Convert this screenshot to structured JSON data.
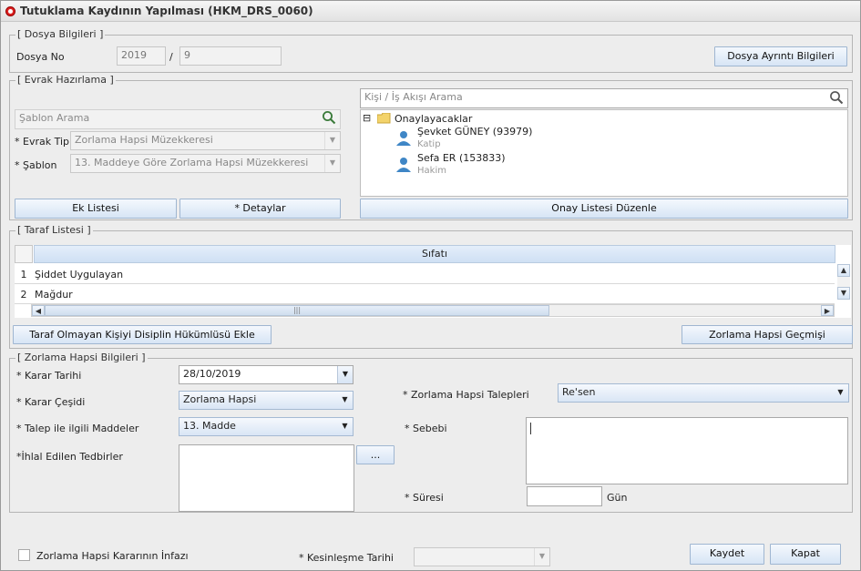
{
  "window": {
    "title": "Tutuklama Kaydının Yapılması (HKM_DRS_0060)"
  },
  "dosya": {
    "legend": "[ Dosya Bilgileri ]",
    "label": "Dosya No",
    "year": "2019",
    "sep": "/",
    "no": "9",
    "detail_button": "Dosya Ayrıntı Bilgileri"
  },
  "evrak": {
    "legend": "[ Evrak Hazırlama ]",
    "sablon_search_placeholder": "Şablon Arama",
    "evrak_tipi_label": "* Evrak Tipi",
    "evrak_tipi_value": "Zorlama Hapsi Müzekkeresi",
    "sablon_label": "* Şablon",
    "sablon_value": "13. Maddeye Göre Zorlama Hapsi Müzekkeresi",
    "ek_listesi_button": "Ek Listesi",
    "detaylar_button": "* Detaylar",
    "kisi_search_placeholder": "Kişi / İş Akışı Arama",
    "tree": {
      "toggle": "⊟",
      "root": "Onaylayacaklar",
      "people": [
        {
          "name": "Şevket GÜNEY (93979)",
          "role": "Katip"
        },
        {
          "name": "Sefa ER (153833)",
          "role": "Hakim"
        }
      ]
    },
    "onay_button": "Onay Listesi Düzenle"
  },
  "taraf": {
    "legend": "[ Taraf Listesi ]",
    "column_header": "Sıfatı",
    "rows": [
      {
        "num": "1",
        "text": "Şiddet Uygulayan"
      },
      {
        "num": "2",
        "text": "Mağdur"
      }
    ],
    "hscroll_grip": "|||",
    "btn_disiplin": "Taraf Olmayan Kişiyi Disiplin Hükümlüsü Ekle",
    "btn_gecmis": "Zorlama Hapsi Geçmişi"
  },
  "zorlama": {
    "legend": "[ Zorlama Hapsi Bilgileri ]",
    "karar_tarihi_label": "* Karar Tarihi",
    "karar_tarihi_value": "28/10/2019",
    "karar_cesidi_label": "* Karar Çeşidi",
    "karar_cesidi_value": "Zorlama Hapsi",
    "talep_maddeler_label": "* Talep ile ilgili Maddeler",
    "talep_maddeler_value": "13. Madde",
    "ihlal_label": "*İhlal Edilen Tedbirler",
    "ihlal_button": "...",
    "talepleri_label": "* Zorlama Hapsi Talepleri",
    "talepleri_value": "Re'sen",
    "sebebi_label": "* Sebebi",
    "suresi_label": "* Süresi",
    "suresi_value": "",
    "suresi_unit": "Gün"
  },
  "footer": {
    "infaz_label": "Zorlama Hapsi Kararının İnfazı",
    "kesinlesme_label": "* Kesinleşme Tarihi",
    "kesinlesme_value": "",
    "kaydet_button": "Kaydet",
    "kapat_button": "Kapat"
  },
  "colors": {
    "button_top": "#f4f8fd",
    "button_bottom": "#d7e5f5",
    "header_blue": "#cfe0f4",
    "person_icon": "#3f86c6"
  }
}
